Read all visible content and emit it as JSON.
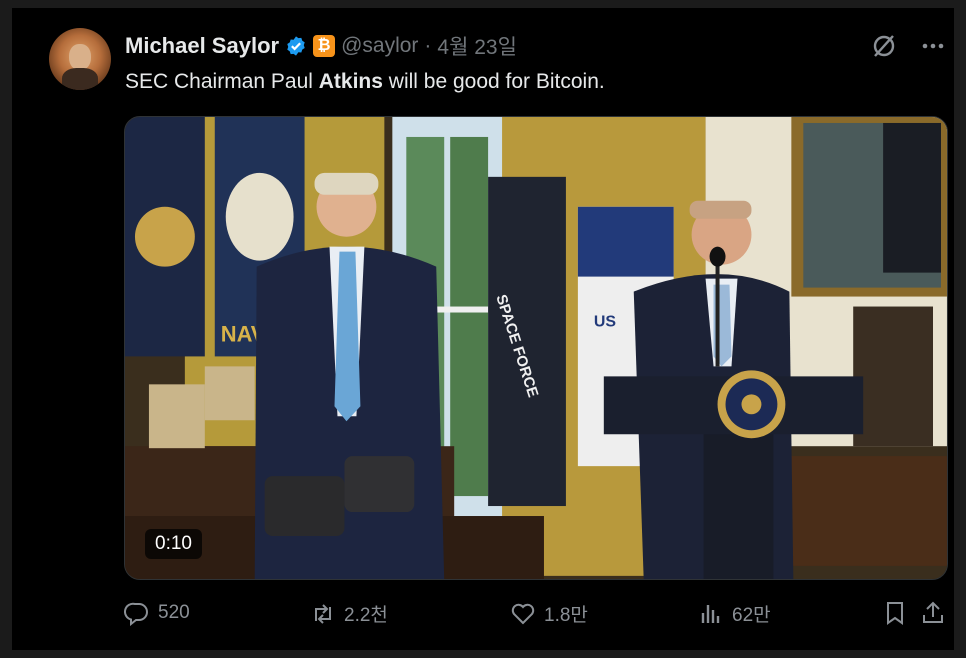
{
  "tweet": {
    "author_name": "Michael Saylor",
    "handle": "@saylor",
    "separator": "·",
    "date": "4월 23일",
    "text_before": "SEC Chairman Paul ",
    "text_bold": "Atkins",
    "text_after": " will be good for Bitcoin.",
    "affiliation_badge": "₿"
  },
  "media": {
    "duration": "0:10",
    "flag_text_left": "NAVY",
    "flag_text_center": "SPACE FORCE",
    "flag_text_right": "US",
    "seal_text": "SEAL OF THE PRESIDENT OF THE UNITED STATES"
  },
  "actions": {
    "replies": "520",
    "reposts": "2.2천",
    "likes": "1.8만",
    "views": "62만"
  },
  "colors": {
    "background": "#000000",
    "text": "#e7e9ea",
    "muted": "#71767b",
    "verified": "#1d9bf0",
    "bitcoin": "#f7931a"
  },
  "icons": [
    "verified-badge-icon",
    "bitcoin-affiliation-icon",
    "grok-icon",
    "more-icon",
    "reply-icon",
    "repost-icon",
    "like-icon",
    "views-icon",
    "bookmark-icon",
    "share-icon"
  ]
}
